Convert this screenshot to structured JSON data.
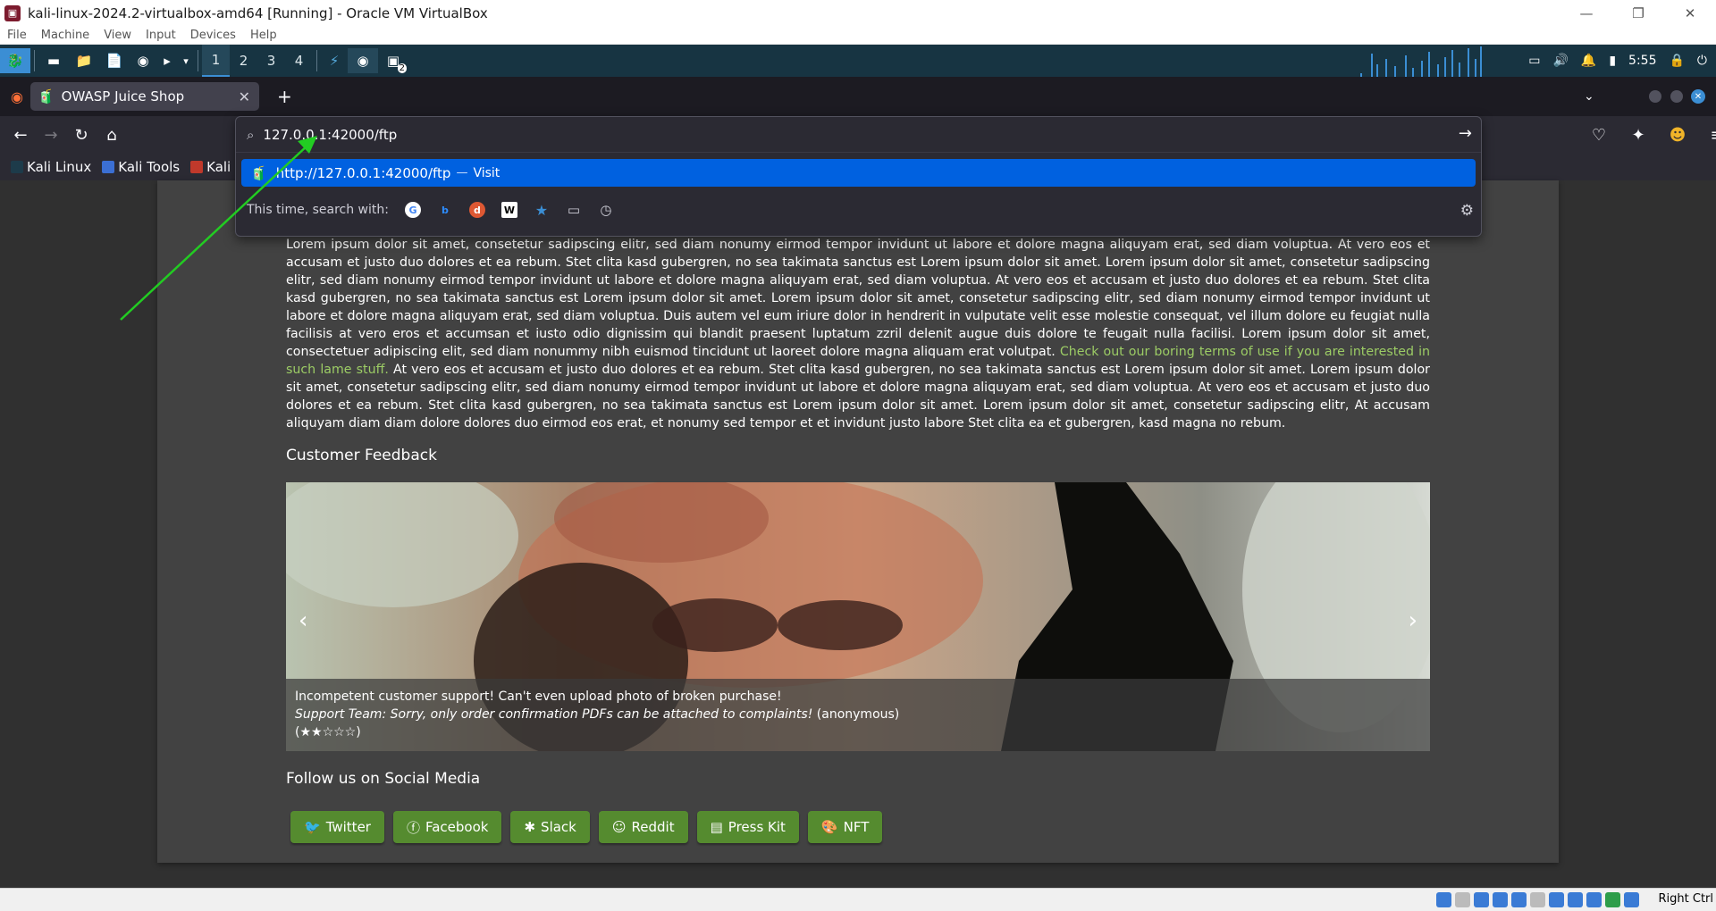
{
  "vbox": {
    "title": "kali-linux-2024.2-virtualbox-amd64 [Running] - Oracle VM VirtualBox",
    "menu": [
      "File",
      "Machine",
      "View",
      "Input",
      "Devices",
      "Help"
    ],
    "host_key": "Right Ctrl"
  },
  "kali_panel": {
    "workspaces": [
      "1",
      "2",
      "3",
      "4"
    ],
    "active_workspace": "1",
    "terminal_badge": "2",
    "clock": "5:55"
  },
  "firefox": {
    "tab_title": "OWASP Juice Shop",
    "url_value": "127.0.0.1:42000/ftp",
    "suggestion_url": "http://127.0.0.1:42000/ftp",
    "suggestion_sep": "—",
    "suggestion_action": "Visit",
    "search_with_label": "This time, search with:",
    "bookmarks": [
      "Kali Linux",
      "Kali Tools",
      "Kali Do"
    ]
  },
  "page": {
    "para_text": "Lorem ipsum dolor sit amet, consetetur sadipscing elitr, sed diam nonumy eirmod tempor invidunt ut labore et dolore magna aliquyam erat, sed diam voluptua. At vero eos et accusam et justo duo dolores et ea rebum. Stet clita kasd gubergren, no sea takimata sanctus est Lorem ipsum dolor sit amet. Lorem ipsum dolor sit amet, consetetur sadipscing elitr, sed diam nonumy eirmod tempor invidunt ut labore et dolore magna aliquyam erat, sed diam voluptua. At vero eos et accusam et justo duo dolores et ea rebum. Stet clita kasd gubergren, no sea takimata sanctus est Lorem ipsum dolor sit amet. Lorem ipsum dolor sit amet, consetetur sadipscing elitr, sed diam nonumy eirmod tempor invidunt ut labore et dolore magna aliquyam erat, sed diam voluptua. Duis autem vel eum iriure dolor in hendrerit in vulputate velit esse molestie consequat, vel illum dolore eu feugiat nulla facilisis at vero eros et accumsan et iusto odio dignissim qui blandit praesent luptatum zzril delenit augue duis dolore te feugait nulla facilisi. Lorem ipsum dolor sit amet, consectetuer adipiscing elit, sed diam nonummy nibh euismod tincidunt ut laoreet dolore magna aliquam erat volutpat.",
    "terms_link": "Check out our boring terms of use if you are interested in such lame stuff.",
    "para_text_2": "At vero eos et accusam et justo duo dolores et ea rebum. Stet clita kasd gubergren, no sea takimata sanctus est Lorem ipsum dolor sit amet. Lorem ipsum dolor sit amet, consetetur sadipscing elitr, sed diam nonumy eirmod tempor invidunt ut labore et dolore magna aliquyam erat, sed diam voluptua. At vero eos et accusam et justo duo dolores et ea rebum. Stet clita kasd gubergren, no sea takimata sanctus est Lorem ipsum dolor sit amet. Lorem ipsum dolor sit amet, consetetur sadipscing elitr, At accusam aliquyam diam diam dolore dolores duo eirmod eos erat, et nonumy sed tempor et et invidunt justo labore Stet clita ea et gubergren, kasd magna no rebum.",
    "feedback_heading": "Customer Feedback",
    "feedback": {
      "text": "Incompetent customer support! Can't even upload photo of broken purchase!",
      "reply": "Support Team: Sorry, only order confirmation PDFs can be attached to complaints!",
      "author": "(anonymous)",
      "rating_display": "(★★☆☆☆)",
      "rating": 2,
      "rating_max": 5
    },
    "social_heading": "Follow us on Social Media",
    "social_buttons": [
      "Twitter",
      "Facebook",
      "Slack",
      "Reddit",
      "Press Kit",
      "NFT"
    ]
  },
  "colors": {
    "kali_panel": "#173442",
    "firefox_bg": "#2b2a33",
    "highlight": "#0061e0",
    "juice_button": "#558b2f",
    "link_green": "#9ccc65",
    "annotation_arrow": "#22cc22"
  }
}
